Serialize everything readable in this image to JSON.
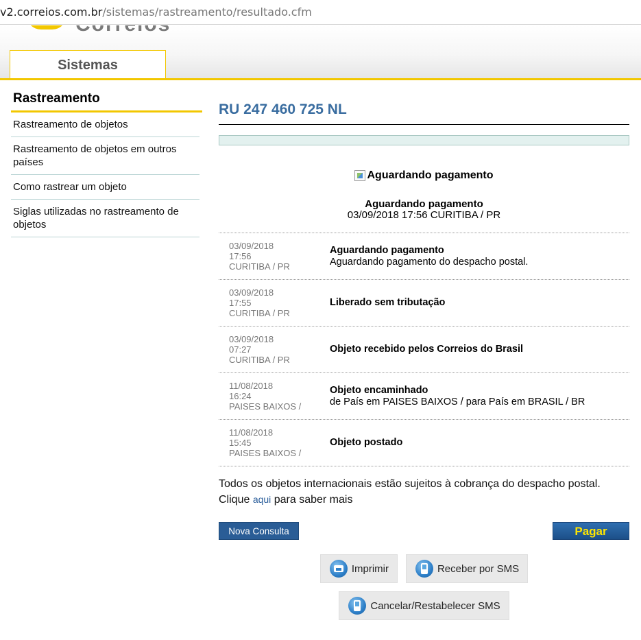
{
  "browser": {
    "url_host": "v2.correios.com.br",
    "url_path": "/sistemas/rastreamento/resultado.cfm"
  },
  "header": {
    "logo_partial": "Correios",
    "tab_label": "Sistemas"
  },
  "sidebar": {
    "heading": "Rastreamento",
    "items": [
      {
        "label": "Rastreamento de objetos"
      },
      {
        "label": "Rastreamento de objetos em outros países"
      },
      {
        "label": "Como rastrear um objeto"
      },
      {
        "label": "Siglas utilizadas no rastreamento de objetos"
      }
    ]
  },
  "main": {
    "tracking_code": "RU 247 460 725 NL",
    "status_image_alt": "Aguardando pagamento",
    "current_status": {
      "title": "Aguardando pagamento",
      "detail": "03/09/2018 17:56 CURITIBA / PR"
    },
    "events": [
      {
        "date": "03/09/2018",
        "time": "17:56",
        "place": "CURITIBA / PR",
        "title": "Aguardando pagamento",
        "detail": "Aguardando pagamento do despacho postal."
      },
      {
        "date": "03/09/2018",
        "time": "17:55",
        "place": "CURITIBA / PR",
        "title": "Liberado sem tributação",
        "detail": ""
      },
      {
        "date": "03/09/2018",
        "time": "07:27",
        "place": "CURITIBA / PR",
        "title": "Objeto recebido pelos Correios do Brasil",
        "detail": ""
      },
      {
        "date": "11/08/2018",
        "time": "16:24",
        "place": "PAISES BAIXOS /",
        "title": "Objeto encaminhado",
        "detail": "de País em PAISES BAIXOS / para País em BRASIL / BR"
      },
      {
        "date": "11/08/2018",
        "time": "15:45",
        "place": "PAISES BAIXOS /",
        "title": "Objeto postado",
        "detail": ""
      }
    ],
    "notice_line1": "Todos os objetos internacionais estão sujeitos à cobrança do despacho postal.",
    "notice_prefix": "Clique",
    "notice_link": "aqui",
    "notice_suffix": "para saber mais",
    "buttons": {
      "nova_consulta": "Nova Consulta",
      "pagar": "Pagar",
      "imprimir": "Imprimir",
      "receber_sms": "Receber por SMS",
      "cancelar_sms": "Cancelar/Restabelecer SMS"
    }
  },
  "colors": {
    "accent_yellow": "#f2c700",
    "title_blue": "#3a6da0",
    "button_blue": "#2a5d96",
    "pagar_text": "#ffe600"
  }
}
